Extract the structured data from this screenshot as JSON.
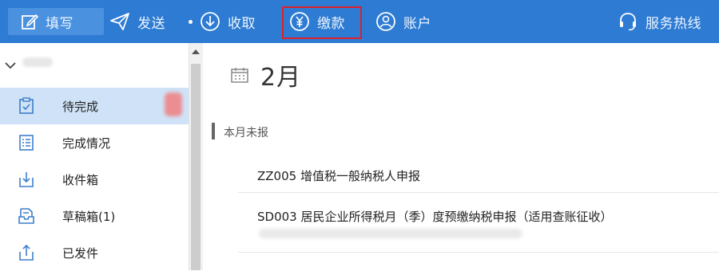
{
  "toolbar": {
    "fill_label": "填写",
    "send_label": "发送",
    "receive_label": "收取",
    "pay_label": "缴款",
    "account_label": "账户",
    "hotline_label": "服务热线"
  },
  "sidebar": {
    "items": [
      {
        "label": "待完成",
        "icon": "clipboard-check-icon"
      },
      {
        "label": "完成情况",
        "icon": "list-icon"
      },
      {
        "label": "收件箱",
        "icon": "inbox-download-icon"
      },
      {
        "label": "草稿箱(1)",
        "icon": "drafts-icon"
      },
      {
        "label": "已发件",
        "icon": "upload-icon"
      }
    ]
  },
  "main": {
    "month": "2月",
    "section_title": "本月未报",
    "tasks": [
      {
        "label": "ZZ005 增值税一般纳税人申报"
      },
      {
        "label": "SD003 居民企业所得税月（季）度预缴纳税申报（适用查账征收）"
      }
    ]
  },
  "colors": {
    "toolbar_bg": "#2d7bd3",
    "highlight_box": "#e0202a",
    "active_item_bg": "#cfe2f7"
  }
}
